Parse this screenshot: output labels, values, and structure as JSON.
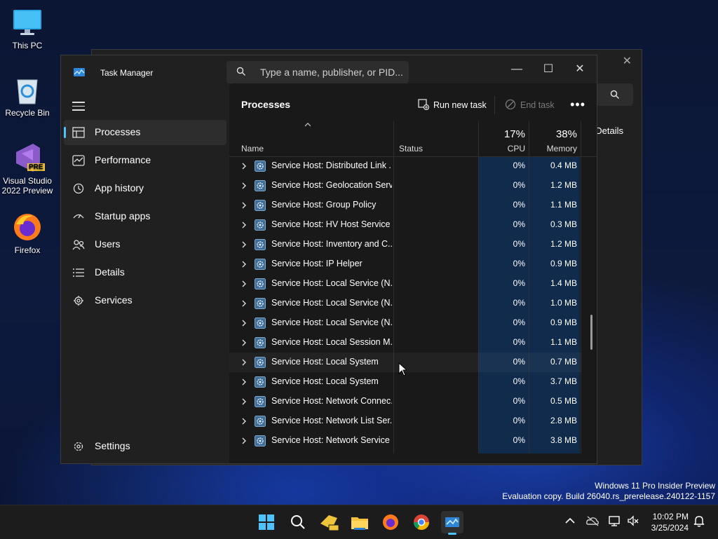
{
  "desktop": {
    "icons": [
      {
        "label": "This PC",
        "icon": "monitor-icon"
      },
      {
        "label": "Recycle Bin",
        "icon": "recycle-bin-icon"
      },
      {
        "label_line1": "Visual Studio",
        "label_line2": "2022 Preview",
        "badge": "PRE",
        "icon": "visual-studio-icon"
      },
      {
        "label": "Firefox",
        "icon": "firefox-icon"
      }
    ],
    "watermark_line1": "Windows 11 Pro Insider Preview",
    "watermark_line2": "Evaluation copy. Build 26040.rs_prerelease.240122-1157"
  },
  "back_window": {
    "details_label": "Details"
  },
  "window": {
    "title": "Task Manager",
    "search_placeholder": "Type a name, publisher, or PID...",
    "controls": {
      "minimize": "—",
      "maximize": "☐",
      "close": "✕"
    }
  },
  "nav": {
    "items": [
      {
        "label": "Processes",
        "icon": "processes-icon",
        "selected": true
      },
      {
        "label": "Performance",
        "icon": "performance-icon"
      },
      {
        "label": "App history",
        "icon": "app-history-icon"
      },
      {
        "label": "Startup apps",
        "icon": "startup-apps-icon"
      },
      {
        "label": "Users",
        "icon": "users-icon"
      },
      {
        "label": "Details",
        "icon": "details-icon"
      },
      {
        "label": "Services",
        "icon": "services-icon"
      }
    ],
    "settings_label": "Settings"
  },
  "toolbar": {
    "title": "Processes",
    "run_new_task": "Run new task",
    "end_task": "End task",
    "more": "•••"
  },
  "columns": {
    "name": "Name",
    "status": "Status",
    "cpu_pct": "17%",
    "cpu": "CPU",
    "mem_pct": "38%",
    "mem": "Memory"
  },
  "rows": [
    {
      "name": "Service Host: Distributed Link ...",
      "cpu": "0%",
      "mem": "0.4 MB"
    },
    {
      "name": "Service Host: Geolocation Serv...",
      "cpu": "0%",
      "mem": "1.2 MB"
    },
    {
      "name": "Service Host: Group Policy",
      "cpu": "0%",
      "mem": "1.1 MB"
    },
    {
      "name": "Service Host: HV Host Service",
      "cpu": "0%",
      "mem": "0.3 MB"
    },
    {
      "name": "Service Host: Inventory and C...",
      "cpu": "0%",
      "mem": "1.2 MB"
    },
    {
      "name": "Service Host: IP Helper",
      "cpu": "0%",
      "mem": "0.9 MB"
    },
    {
      "name": "Service Host: Local Service (N...",
      "cpu": "0%",
      "mem": "1.4 MB"
    },
    {
      "name": "Service Host: Local Service (N...",
      "cpu": "0%",
      "mem": "1.0 MB"
    },
    {
      "name": "Service Host: Local Service (N...",
      "cpu": "0%",
      "mem": "0.9 MB"
    },
    {
      "name": "Service Host: Local Session M...",
      "cpu": "0%",
      "mem": "1.1 MB"
    },
    {
      "name": "Service Host: Local System",
      "cpu": "0%",
      "mem": "0.7 MB"
    },
    {
      "name": "Service Host: Local System",
      "cpu": "0%",
      "mem": "3.7 MB"
    },
    {
      "name": "Service Host: Network Connec...",
      "cpu": "0%",
      "mem": "0.5 MB"
    },
    {
      "name": "Service Host: Network List Ser...",
      "cpu": "0%",
      "mem": "2.8 MB"
    },
    {
      "name": "Service Host: Network Service",
      "cpu": "0%",
      "mem": "3.8 MB"
    }
  ],
  "taskbar": {
    "apps": [
      "start-icon",
      "search-icon",
      "visual-studio-preview-icon",
      "file-explorer-icon",
      "firefox-icon",
      "chrome-icon",
      "task-manager-icon"
    ],
    "time": "10:02 PM",
    "date": "3/25/2024"
  },
  "colors": {
    "accent": "#4cc2ff",
    "heat": "#112b4c"
  }
}
